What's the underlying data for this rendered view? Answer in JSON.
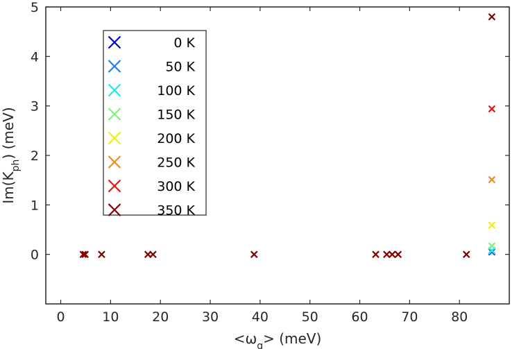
{
  "chart_data": {
    "type": "scatter",
    "title": "",
    "xlabel": {
      "main": "<ω",
      "sub": "q",
      "tail": "> (meV)"
    },
    "ylabel": {
      "main": "Im(K",
      "sub": "ph",
      "tail": ") (meV)"
    },
    "xlim": [
      -3,
      90
    ],
    "ylim": [
      -1,
      5
    ],
    "xticks": [
      0,
      10,
      20,
      30,
      40,
      50,
      60,
      70,
      80
    ],
    "yticks": [
      0,
      1,
      2,
      3,
      4,
      5
    ],
    "legend_position": "top-left",
    "grid": false,
    "series": [
      {
        "name": "0 K",
        "color": "#0000cd",
        "points": [
          [
            86.5,
            0.05
          ]
        ]
      },
      {
        "name": "50 K",
        "color": "#1e7ff0",
        "points": [
          [
            86.5,
            0.06
          ]
        ]
      },
      {
        "name": "100 K",
        "color": "#22e8f0",
        "points": [
          [
            86.5,
            0.08
          ]
        ]
      },
      {
        "name": "150 K",
        "color": "#7ef07e",
        "points": [
          [
            86.5,
            0.17
          ]
        ]
      },
      {
        "name": "200 K",
        "color": "#f0f000",
        "points": [
          [
            86.5,
            0.59
          ]
        ]
      },
      {
        "name": "250 K",
        "color": "#f08c1e",
        "points": [
          [
            86.5,
            1.51
          ]
        ]
      },
      {
        "name": "300 K",
        "color": "#e81414",
        "points": [
          [
            86.5,
            2.94
          ]
        ]
      },
      {
        "name": "350 K",
        "color": "#800000",
        "points": [
          [
            4.5,
            0
          ],
          [
            4.9,
            0
          ],
          [
            8.2,
            0
          ],
          [
            17.5,
            0
          ],
          [
            18.5,
            0
          ],
          [
            38.8,
            0
          ],
          [
            63.2,
            0
          ],
          [
            65.4,
            0
          ],
          [
            66.5,
            0
          ],
          [
            67.7,
            0
          ],
          [
            81.4,
            0
          ],
          [
            86.5,
            4.8
          ]
        ]
      }
    ]
  }
}
